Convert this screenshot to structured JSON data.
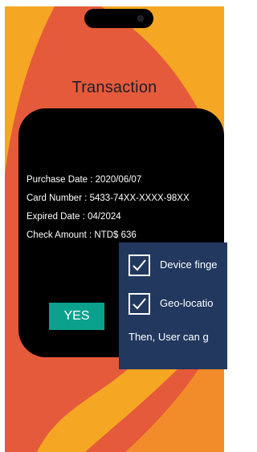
{
  "screen": {
    "title": "Transaction",
    "colors": {
      "background": "#e55a3a",
      "wave": "#f5a623",
      "card": "#000000",
      "accent": "#0aa28d",
      "popup": "#22385f"
    }
  },
  "transaction": {
    "purchase_date": "Purchase Date : 2020/06/07",
    "card_number": "Card Number : 5433-74XX-XXXX-98XX",
    "expired_date": "Expired Date : 04/2024",
    "check_amount": "Check Amount : NTD$ 636",
    "yes_label": "YES"
  },
  "verification": {
    "items": [
      {
        "label": "Device finge",
        "icon": "checkbox-checked-icon"
      },
      {
        "label": "Geo-locatio",
        "icon": "checkbox-checked-icon"
      }
    ],
    "footer": "Then, User can g"
  }
}
